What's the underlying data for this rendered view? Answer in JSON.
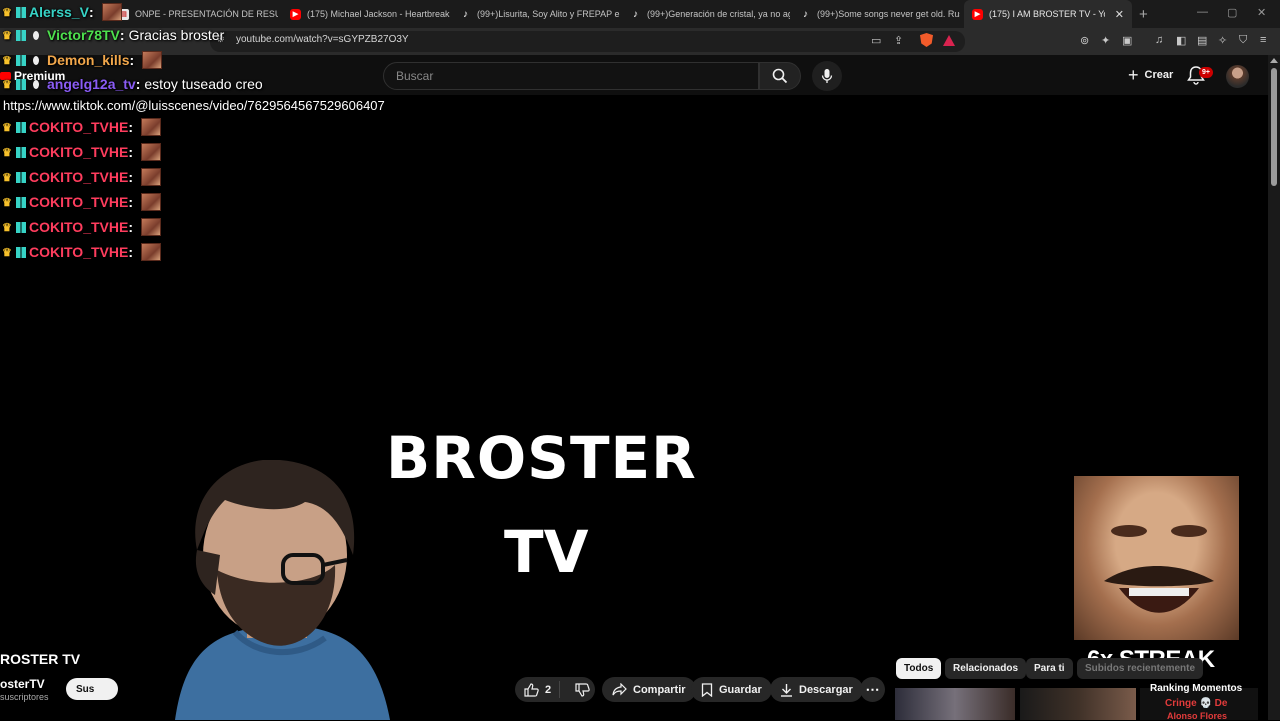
{
  "browser": {
    "tabs": [
      {
        "title": "ONPE - PRESENTACIÓN DE RESULTA",
        "icon": "document-icon"
      },
      {
        "title": "(175) Michael Jackson - Heartbreak",
        "icon": "youtube-icon"
      },
      {
        "title": "(99+)Lisurita, Soy Alito y FREPAP en",
        "icon": "tiktok-icon"
      },
      {
        "title": "(99+)Generación de cristal, ya no ag",
        "icon": "tiktok-icon"
      },
      {
        "title": "(99+)Some songs never get old. Rus",
        "icon": "tiktok-icon"
      },
      {
        "title": "(175) I AM BROSTER TV - YouTu",
        "icon": "youtube-icon",
        "active": true
      }
    ],
    "url": "youtube.com/watch?v=sGYPZB27O3Y"
  },
  "youtube": {
    "logo_label": "Premium",
    "search_placeholder": "Buscar",
    "create_label": "Crear",
    "notifications_badge": "9+"
  },
  "chat": {
    "messages": [
      {
        "user": "Alerss_V",
        "color": "#37d3c6",
        "text": "",
        "emote": true
      },
      {
        "user": "Victor78TV",
        "color": "#4ee04e",
        "text": "Gracias broster",
        "emote": false
      },
      {
        "user": "Demon_kills",
        "color": "#f2a74b",
        "text": "",
        "emote": true
      },
      {
        "user": "angelg12a_tv",
        "color": "#8a5cf5",
        "text": "estoy tuseado creo",
        "emote": false
      },
      {
        "user": "COKITO_TVHE",
        "color": "#ff3d5e",
        "text": "",
        "emote": true
      },
      {
        "user": "COKITO_TVHE",
        "color": "#ff3d5e",
        "text": "",
        "emote": true
      },
      {
        "user": "COKITO_TVHE",
        "color": "#ff3d5e",
        "text": "",
        "emote": true
      },
      {
        "user": "COKITO_TVHE",
        "color": "#ff3d5e",
        "text": "",
        "emote": true
      },
      {
        "user": "COKITO_TVHE",
        "color": "#ff3d5e",
        "text": "",
        "emote": true
      },
      {
        "user": "COKITO_TVHE",
        "color": "#ff3d5e",
        "text": "",
        "emote": true
      }
    ],
    "link_text": "https://www.tiktok.com/@luisscenes/video/7629564567529606407"
  },
  "video": {
    "title_line_1": "BROSTER",
    "title_line_2": "TV",
    "streak_text": "6x STREAK"
  },
  "below_video": {
    "title": "ROSTER TV",
    "channel": "osterTV",
    "subscribers": "suscriptores",
    "subscribe_label": "Sus",
    "like_count": "2",
    "share_label": "Compartir",
    "save_label": "Guardar",
    "download_label": "Descargar"
  },
  "related": {
    "chips": [
      "Todos",
      "Relacionados",
      "Para ti",
      "Subidos recientemente"
    ],
    "thumb3_title": "Ranking Momentos",
    "thumb3_sub": "Cringe 💀 De",
    "thumb3_sub2": "Alonso Flores"
  }
}
